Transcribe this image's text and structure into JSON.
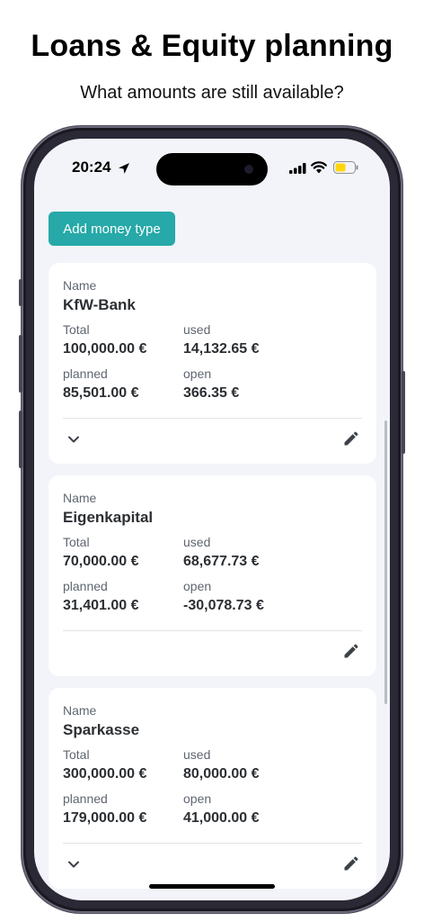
{
  "promo": {
    "title": "Loans & Equity planning",
    "subtitle": "What amounts are still available?"
  },
  "status_bar": {
    "time": "20:24",
    "icons": [
      "location-arrow-icon",
      "cellular-signal-icon",
      "wifi-icon",
      "battery-icon"
    ]
  },
  "toolbar": {
    "add_label": "Add money type"
  },
  "labels": {
    "name": "Name",
    "total": "Total",
    "used": "used",
    "planned": "planned",
    "open": "open"
  },
  "cards": [
    {
      "name": "KfW-Bank",
      "total": "100,000.00 €",
      "used": "14,132.65 €",
      "planned": "85,501.00 €",
      "open": "366.35 €",
      "expandable": true
    },
    {
      "name": "Eigenkapital",
      "total": "70,000.00 €",
      "used": "68,677.73 €",
      "planned": "31,401.00 €",
      "open": "-30,078.73 €",
      "expandable": false
    },
    {
      "name": "Sparkasse",
      "total": "300,000.00 €",
      "used": "80,000.00 €",
      "planned": "179,000.00 €",
      "open": "41,000.00 €",
      "expandable": true
    }
  ],
  "colors": {
    "accent": "#26a9a8",
    "screen_background": "#f2f4f9",
    "card_background": "#ffffff",
    "battery_fill": "#ffd60a"
  }
}
